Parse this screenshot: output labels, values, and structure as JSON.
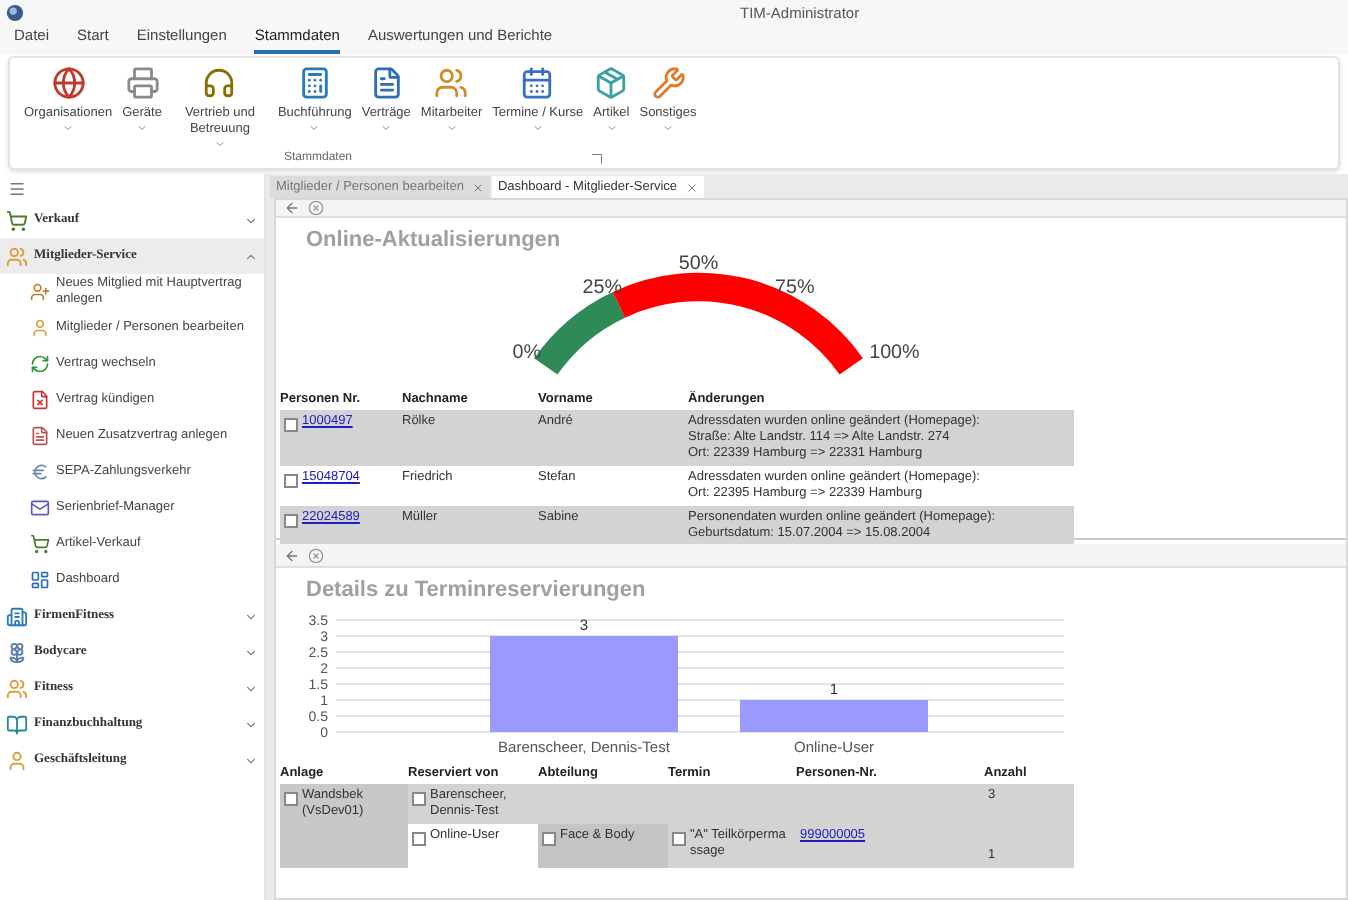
{
  "window": {
    "title": "TIM-Administrator"
  },
  "menu_tabs": [
    {
      "label": "Datei",
      "selected": false
    },
    {
      "label": "Start",
      "selected": false
    },
    {
      "label": "Einstellungen",
      "selected": false
    },
    {
      "label": "Stammdaten",
      "selected": true
    },
    {
      "label": "Auswertungen und Berichte",
      "selected": false
    }
  ],
  "ribbon": {
    "group_label": "Stammdaten",
    "buttons": [
      "Organisationen",
      "Geräte",
      "Vertrieb und Betreuung",
      "Buchführung",
      "Verträge",
      "Mitarbeiter",
      "Termine / Kurse",
      "Artikel",
      "Sonstiges"
    ]
  },
  "sidebar": {
    "items": [
      {
        "label": "Verkauf",
        "expanded": false,
        "selected": false
      },
      {
        "label": "Mitglieder-Service",
        "expanded": true,
        "selected": true,
        "children": [
          "Neues Mitglied mit Hauptvertrag anlegen",
          "Mitglieder / Personen bearbeiten",
          "Vertrag wechseln",
          "Vertrag kündigen",
          "Neuen Zusatzvertrag anlegen",
          "SEPA-Zahlungsverkehr",
          "Serienbrief-Manager",
          "Artikel-Verkauf",
          "Dashboard"
        ]
      },
      {
        "label": "FirmenFitness",
        "expanded": false,
        "selected": false
      },
      {
        "label": "Bodycare",
        "expanded": false,
        "selected": false
      },
      {
        "label": "Fitness",
        "expanded": false,
        "selected": false
      },
      {
        "label": "Finanzbuchhaltung",
        "expanded": false,
        "selected": false
      },
      {
        "label": "Geschäftsleitung",
        "expanded": false,
        "selected": false
      }
    ]
  },
  "doc_tabs": [
    {
      "label": "Mitglieder / Personen bearbeiten",
      "selected": false
    },
    {
      "label": "Dashboard - Mitglieder-Service",
      "selected": true
    }
  ],
  "online_updates": {
    "title": "Online-Aktualisierungen",
    "gauge": {
      "level": 0.27,
      "labels": [
        "0%",
        "25%",
        "50%",
        "75%",
        "100%"
      ]
    },
    "columns": [
      "Personen Nr.",
      "Nachname",
      "Vorname",
      "Änderungen"
    ],
    "rows": [
      {
        "nr": "1000497",
        "nachname": "Rölke",
        "vorname": "André",
        "changes": [
          "Adressdaten wurden online geändert (Homepage):",
          "Straße: Alte Landstr. 114 => Alte Landstr. 274",
          "Ort: 22339 Hamburg => 22331 Hamburg"
        ]
      },
      {
        "nr": "15048704",
        "nachname": "Friedrich",
        "vorname": "Stefan",
        "changes": [
          "Adressdaten wurden online geändert (Homepage):",
          "Ort: 22395 Hamburg => 22339 Hamburg"
        ]
      },
      {
        "nr": "22024589",
        "nachname": "Müller",
        "vorname": "Sabine",
        "changes": [
          "Personendaten wurden online geändert (Homepage):",
          "Geburtsdatum: 15.07.2004 => 15.08.2004"
        ]
      }
    ]
  },
  "reservations": {
    "title": "Details zu Terminreservierungen",
    "chart_data": {
      "type": "bar",
      "categories": [
        "Barenscheer, Dennis-Test",
        "Online-User"
      ],
      "values": [
        3,
        1
      ],
      "ylim": [
        0,
        3.5
      ],
      "yticks": [
        0,
        0.5,
        1,
        1.5,
        2,
        2.5,
        3,
        3.5
      ],
      "grid": true,
      "data_labels": true
    },
    "columns": [
      "Anlage",
      "Reserviert von",
      "Abteilung",
      "Termin",
      "Personen-Nr.",
      "Anzahl"
    ],
    "anlage": "Wandsbek (VsDev01)",
    "rows": [
      {
        "reserviert": "Barenscheer, Dennis-Test",
        "anzahl": "3"
      },
      {
        "reserviert": "Online-User",
        "abteilung": "Face & Body",
        "termin": "\"A\" Teilkörpermassage",
        "personen_nr": "999000005",
        "anzahl": "1"
      }
    ]
  }
}
